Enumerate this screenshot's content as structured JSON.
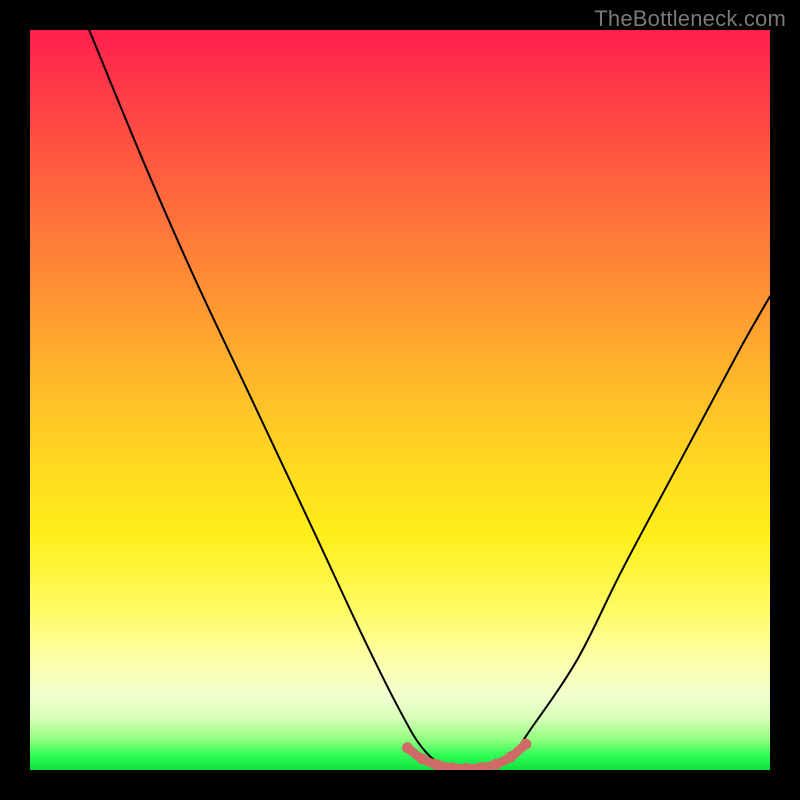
{
  "watermark": "TheBottleneck.com",
  "chart_data": {
    "type": "line",
    "title": "",
    "xlabel": "",
    "ylabel": "",
    "xlim": [
      0,
      100
    ],
    "ylim": [
      0,
      100
    ],
    "grid": false,
    "legend": false,
    "series": [
      {
        "name": "bottleneck-curve",
        "color": "#000000",
        "x": [
          8,
          15,
          22,
          30,
          38,
          45,
          50,
          53,
          56,
          59,
          62,
          65,
          68,
          74,
          80,
          88,
          96,
          100
        ],
        "y": [
          100,
          83,
          67,
          50,
          33,
          18,
          8,
          3,
          0.5,
          0,
          0.5,
          2,
          6,
          15,
          27,
          42,
          57,
          64
        ]
      },
      {
        "name": "optimal-range-marker",
        "color": "#cf6a67",
        "x": [
          51,
          53,
          55,
          57,
          59,
          61,
          63,
          65,
          67
        ],
        "y": [
          3.0,
          1.5,
          0.7,
          0.3,
          0.2,
          0.3,
          0.8,
          1.8,
          3.5
        ]
      }
    ],
    "annotations": []
  }
}
